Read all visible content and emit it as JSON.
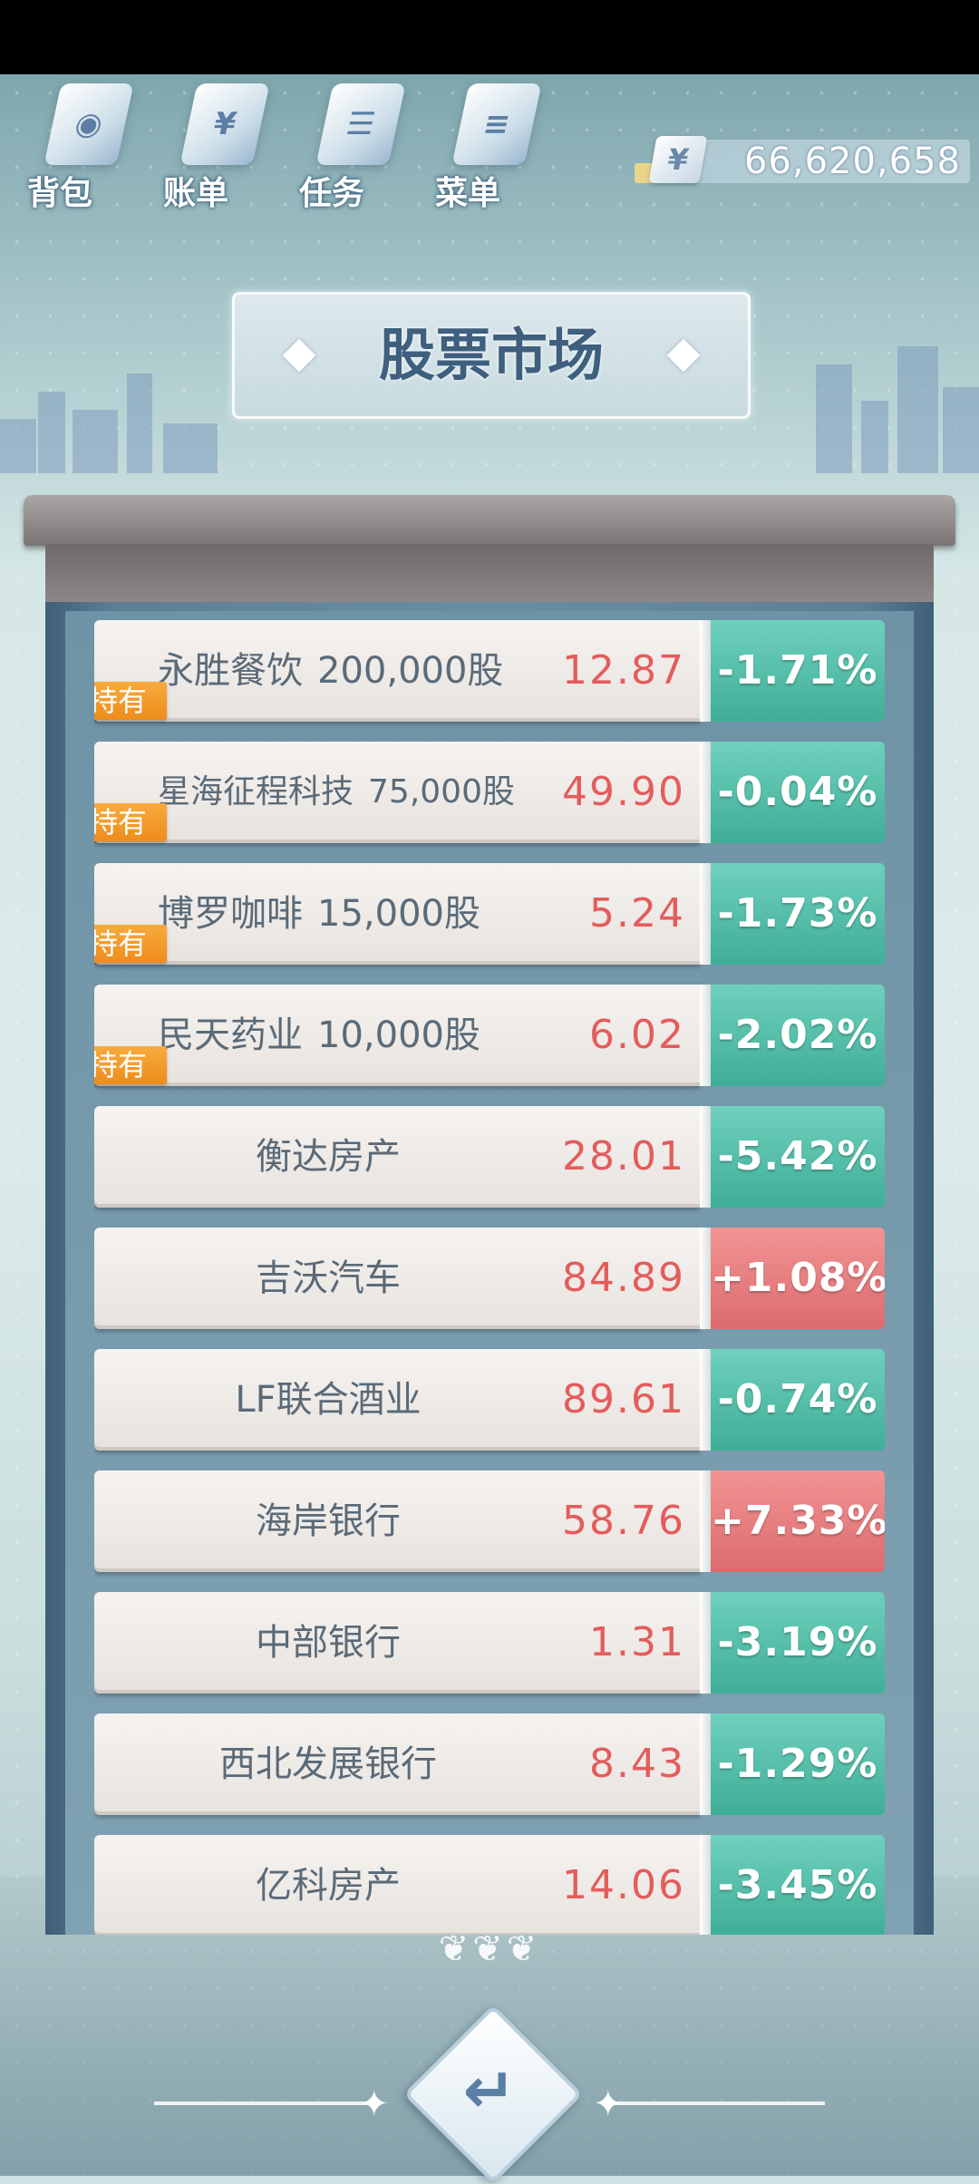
{
  "nav": {
    "items": [
      {
        "label": "背包",
        "icon": "backpack-icon"
      },
      {
        "label": "账单",
        "icon": "bill-icon",
        "glyph": "¥"
      },
      {
        "label": "任务",
        "icon": "task-icon"
      },
      {
        "label": "菜单",
        "icon": "menu-icon"
      }
    ]
  },
  "wallet": {
    "currency": "¥",
    "amount": "66,620,658"
  },
  "title": "股票市场",
  "stocks": [
    {
      "name": "永胜餐饮",
      "shares": "200,000股",
      "price": "12.87",
      "change": "-1.71%",
      "trend": "down",
      "held": "持有"
    },
    {
      "name": "星海征程科技",
      "shares": "75,000股",
      "price": "49.90",
      "change": "-0.04%",
      "trend": "down",
      "held": "持有"
    },
    {
      "name": "博罗咖啡",
      "shares": "15,000股",
      "price": "5.24",
      "change": "-1.73%",
      "trend": "down",
      "held": "持有"
    },
    {
      "name": "民天药业",
      "shares": "10,000股",
      "price": "6.02",
      "change": "-2.02%",
      "trend": "down",
      "held": "持有"
    },
    {
      "name": "衡达房产",
      "price": "28.01",
      "change": "-5.42%",
      "trend": "down"
    },
    {
      "name": "吉沃汽车",
      "price": "84.89",
      "change": "+1.08%",
      "trend": "up"
    },
    {
      "name": "LF联合酒业",
      "price": "89.61",
      "change": "-0.74%",
      "trend": "down"
    },
    {
      "name": "海岸银行",
      "price": "58.76",
      "change": "+7.33%",
      "trend": "up"
    },
    {
      "name": "中部银行",
      "price": "1.31",
      "change": "-3.19%",
      "trend": "down"
    },
    {
      "name": "西北发展银行",
      "price": "8.43",
      "change": "-1.29%",
      "trend": "down"
    },
    {
      "name": "亿科房产",
      "price": "14.06",
      "change": "-3.45%",
      "trend": "down"
    }
  ],
  "colors": {
    "down": "#4cbca5",
    "up": "#e47479",
    "price": "#e45c5c",
    "held_badge": "#f19a2a"
  },
  "back_button": {
    "icon": "back-arrow-icon"
  }
}
